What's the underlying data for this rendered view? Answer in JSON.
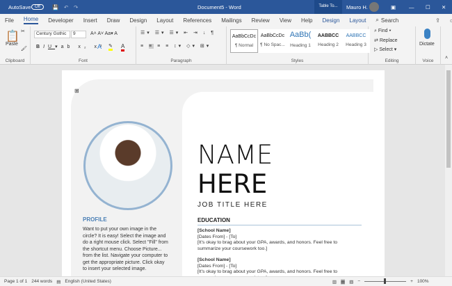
{
  "titlebar": {
    "autosave": "AutoSave",
    "toggle": "Off",
    "title": "Document5  -  Word",
    "context": "Table To...",
    "user": "Mauro H."
  },
  "tabs": [
    "File",
    "Home",
    "Developer",
    "Insert",
    "Draw",
    "Design",
    "Layout",
    "References",
    "Mailings",
    "Review",
    "View",
    "Help",
    "Design",
    "Layout"
  ],
  "search": "Search",
  "ribbon": {
    "clipboard": {
      "paste": "Paste",
      "label": "Clipboard"
    },
    "font": {
      "name": "Century Gothic",
      "size": "9",
      "label": "Font"
    },
    "paragraph": {
      "label": "Paragraph"
    },
    "styles": {
      "label": "Styles",
      "items": [
        {
          "sample": "AaBbCcDc",
          "name": "¶ Normal"
        },
        {
          "sample": "AaBbCcDc",
          "name": "¶ No Spac..."
        },
        {
          "sample": "AaBb(",
          "name": "Heading 1"
        },
        {
          "sample": "AABBCC",
          "name": "Heading 2"
        },
        {
          "sample": "AABBCC",
          "name": "Heading 3"
        }
      ]
    },
    "editing": {
      "find": "Find",
      "replace": "Replace",
      "select": "Select",
      "label": "Editing"
    },
    "voice": {
      "dictate": "Dictate",
      "label": "Voice"
    }
  },
  "document": {
    "name1": "NAME",
    "name2": "HERE",
    "job_title": "JOB TITLE HERE",
    "profile_heading": "PROFILE",
    "profile_text": "Want to put your own image in the circle?  It is easy!  Select the image and do a right mouse click.  Select \"Fill\" from the shortcut menu.  Choose Picture... from the list.  Navigate your computer to get the appropriate picture.  Click okay to insert your selected image.",
    "education_heading": "EDUCATION",
    "education": [
      {
        "school": "[School Name]",
        "dates": "[Dates From] - [To]",
        "desc": "[It's okay to brag about your GPA, awards, and honors. Feel free to summarize your coursework too.]"
      },
      {
        "school": "[School Name]",
        "dates": "[Dates From] - [To]",
        "desc": "[It's okay to brag about your GPA, awards, and honors. Feel free to summarize your coursework too.]"
      }
    ]
  },
  "status": {
    "page": "Page 1 of 1",
    "words": "244 words",
    "language": "English (United States)",
    "zoom": "100%"
  }
}
